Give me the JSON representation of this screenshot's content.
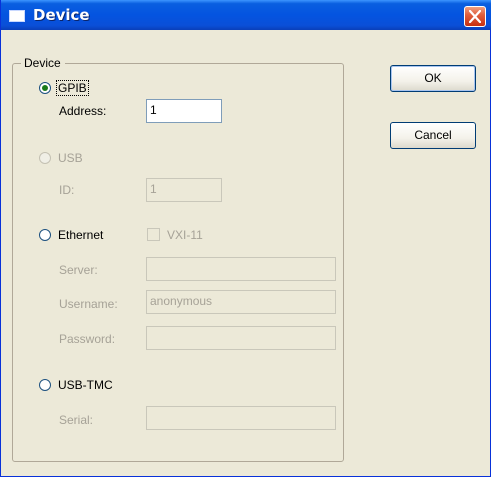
{
  "window": {
    "title": "Device"
  },
  "group": {
    "legend": "Device",
    "gpib": {
      "label": "GPIB",
      "selected": true,
      "address_label": "Address:",
      "address_value": "1"
    },
    "usb": {
      "label": "USB",
      "enabled": false,
      "id_label": "ID:",
      "id_value": "1"
    },
    "ethernet": {
      "label": "Ethernet",
      "vxi_label": "VXI-11",
      "server_label": "Server:",
      "server_value": "",
      "username_label": "Username:",
      "username_value": "anonymous",
      "password_label": "Password:",
      "password_value": ""
    },
    "usbtmc": {
      "label": "USB-TMC",
      "serial_label": "Serial:",
      "serial_value": ""
    }
  },
  "buttons": {
    "ok": "OK",
    "cancel": "Cancel"
  },
  "colors": {
    "titlebar": "#0a5fe0",
    "face": "#ece9d8",
    "disabled_text": "#a6a297",
    "close": "#e06040"
  },
  "icons": {
    "close": "close-icon",
    "window": "window-icon"
  }
}
